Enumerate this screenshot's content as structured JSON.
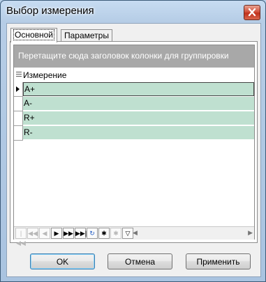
{
  "window": {
    "title": "Выбор измерения"
  },
  "tabs": [
    {
      "label": "Основной",
      "active": true
    },
    {
      "label": "Параметры связи",
      "active": false
    }
  ],
  "grid": {
    "group_bar_text": "Перетащите сюда заголовок колонки для группировки",
    "column_header": "Измерение",
    "rows": [
      "A+",
      "A-",
      "R+",
      "R-"
    ],
    "selected_row": 0
  },
  "navigator": {
    "first": "|◀◀",
    "prev_page": "◀◀",
    "prev": "◀",
    "next": "▶",
    "next_page": "▶▶",
    "last": "▶▶|",
    "refresh": "↻",
    "insert": "✱",
    "post": "✱",
    "filter": "▽"
  },
  "buttons": {
    "ok": "OK",
    "cancel": "Отмена",
    "apply": "Применить"
  },
  "icons": {
    "close": "close-icon",
    "row_indicator": "arrow-right-icon"
  }
}
